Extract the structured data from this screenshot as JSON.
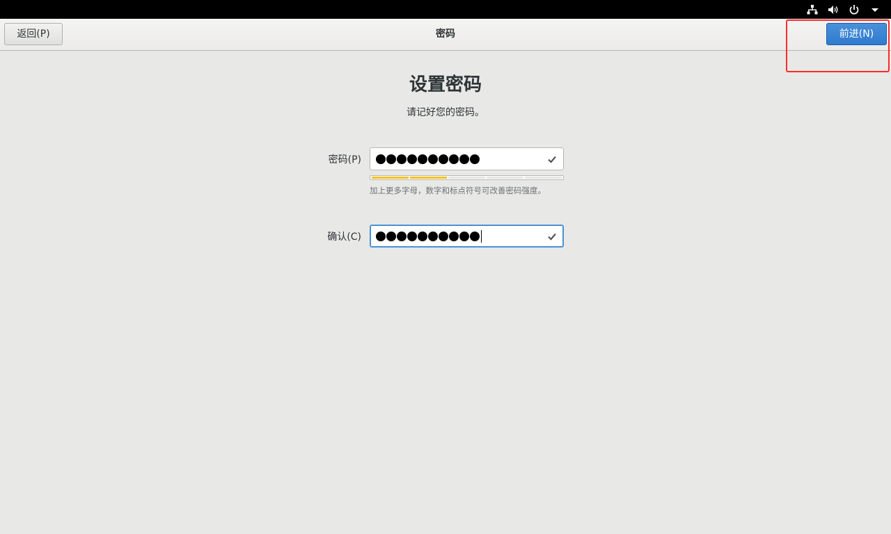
{
  "topbar": {
    "icons": [
      "network-icon",
      "volume-icon",
      "power-icon",
      "chevron-down-icon"
    ]
  },
  "header": {
    "title": "密码",
    "back_label": "返回(P)",
    "next_label": "前进(N)"
  },
  "main": {
    "title": "设置密码",
    "subtitle": "请记好您的密码。",
    "password_label": "密码(P)",
    "confirm_label": "确认(C)",
    "hint": "加上更多字母，数字和标点符号可改善密码强度。",
    "strength_level": 0.4,
    "password_length": 10,
    "confirm_length": 10
  },
  "colors": {
    "accent": "#3584e4",
    "strength_fill": "#f5c211",
    "highlight": "#ff2a2a"
  }
}
